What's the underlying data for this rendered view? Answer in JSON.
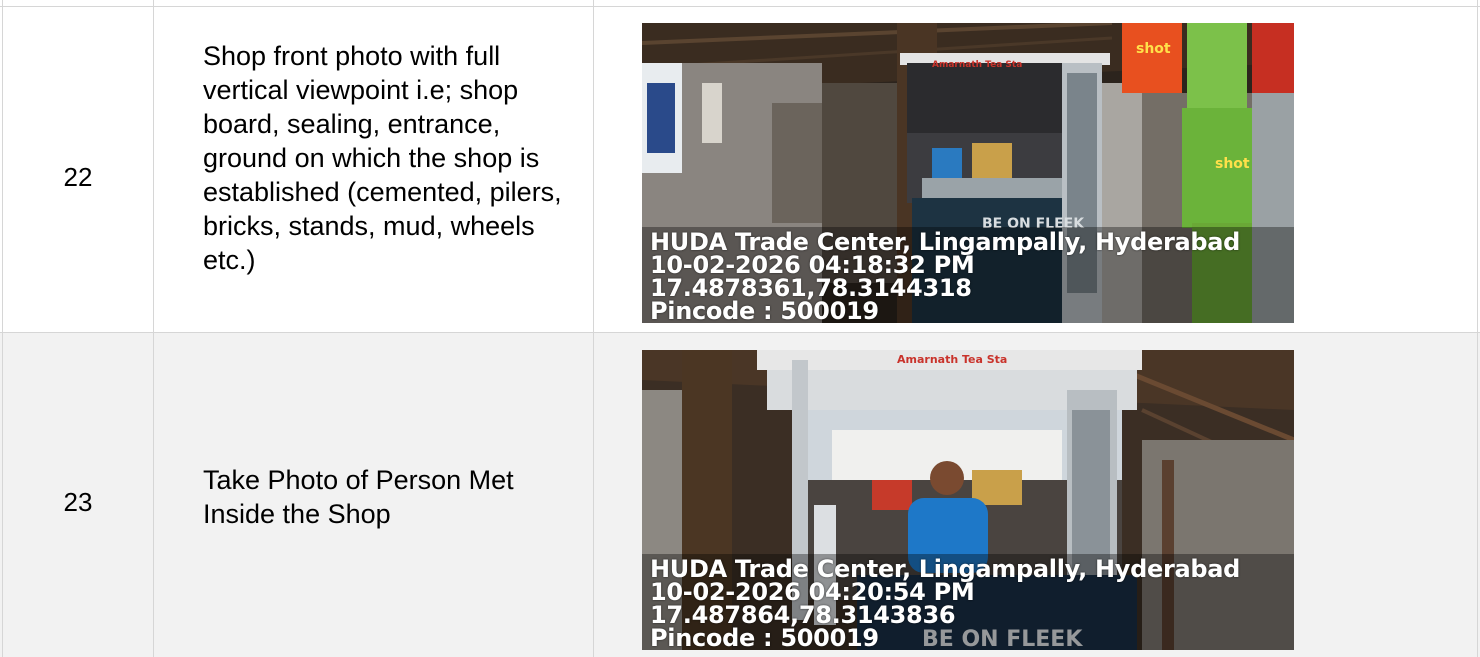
{
  "rows": [
    {
      "number": "22",
      "description": "Shop front photo with full vertical viewpoint i.e; shop board, sealing, entrance, ground on which the shop is established (cemented, pilers, bricks, stands, mud, wheels etc.)",
      "photo": {
        "sign": "Amarnath Tea Sta",
        "snack_brand": "shot",
        "counter_text": "BE ON FLEEK",
        "stamp": {
          "location": "HUDA Trade Center, Lingampally, Hyderabad",
          "datetime": "10-02-2026 04:18:32 PM",
          "coords": "17.4878361,78.3144318",
          "pincode": "Pincode : 500019"
        }
      }
    },
    {
      "number": "23",
      "description": "Take Photo of Person Met Inside the Shop",
      "photo": {
        "sign": "Amarnath Tea Sta",
        "counter_text": "BE ON FLEEK",
        "stamp": {
          "location": "HUDA Trade Center, Lingampally, Hyderabad",
          "datetime": "10-02-2026 04:20:54 PM",
          "coords": "17.487864,78.3143836",
          "pincode": "Pincode : 500019"
        }
      }
    }
  ]
}
